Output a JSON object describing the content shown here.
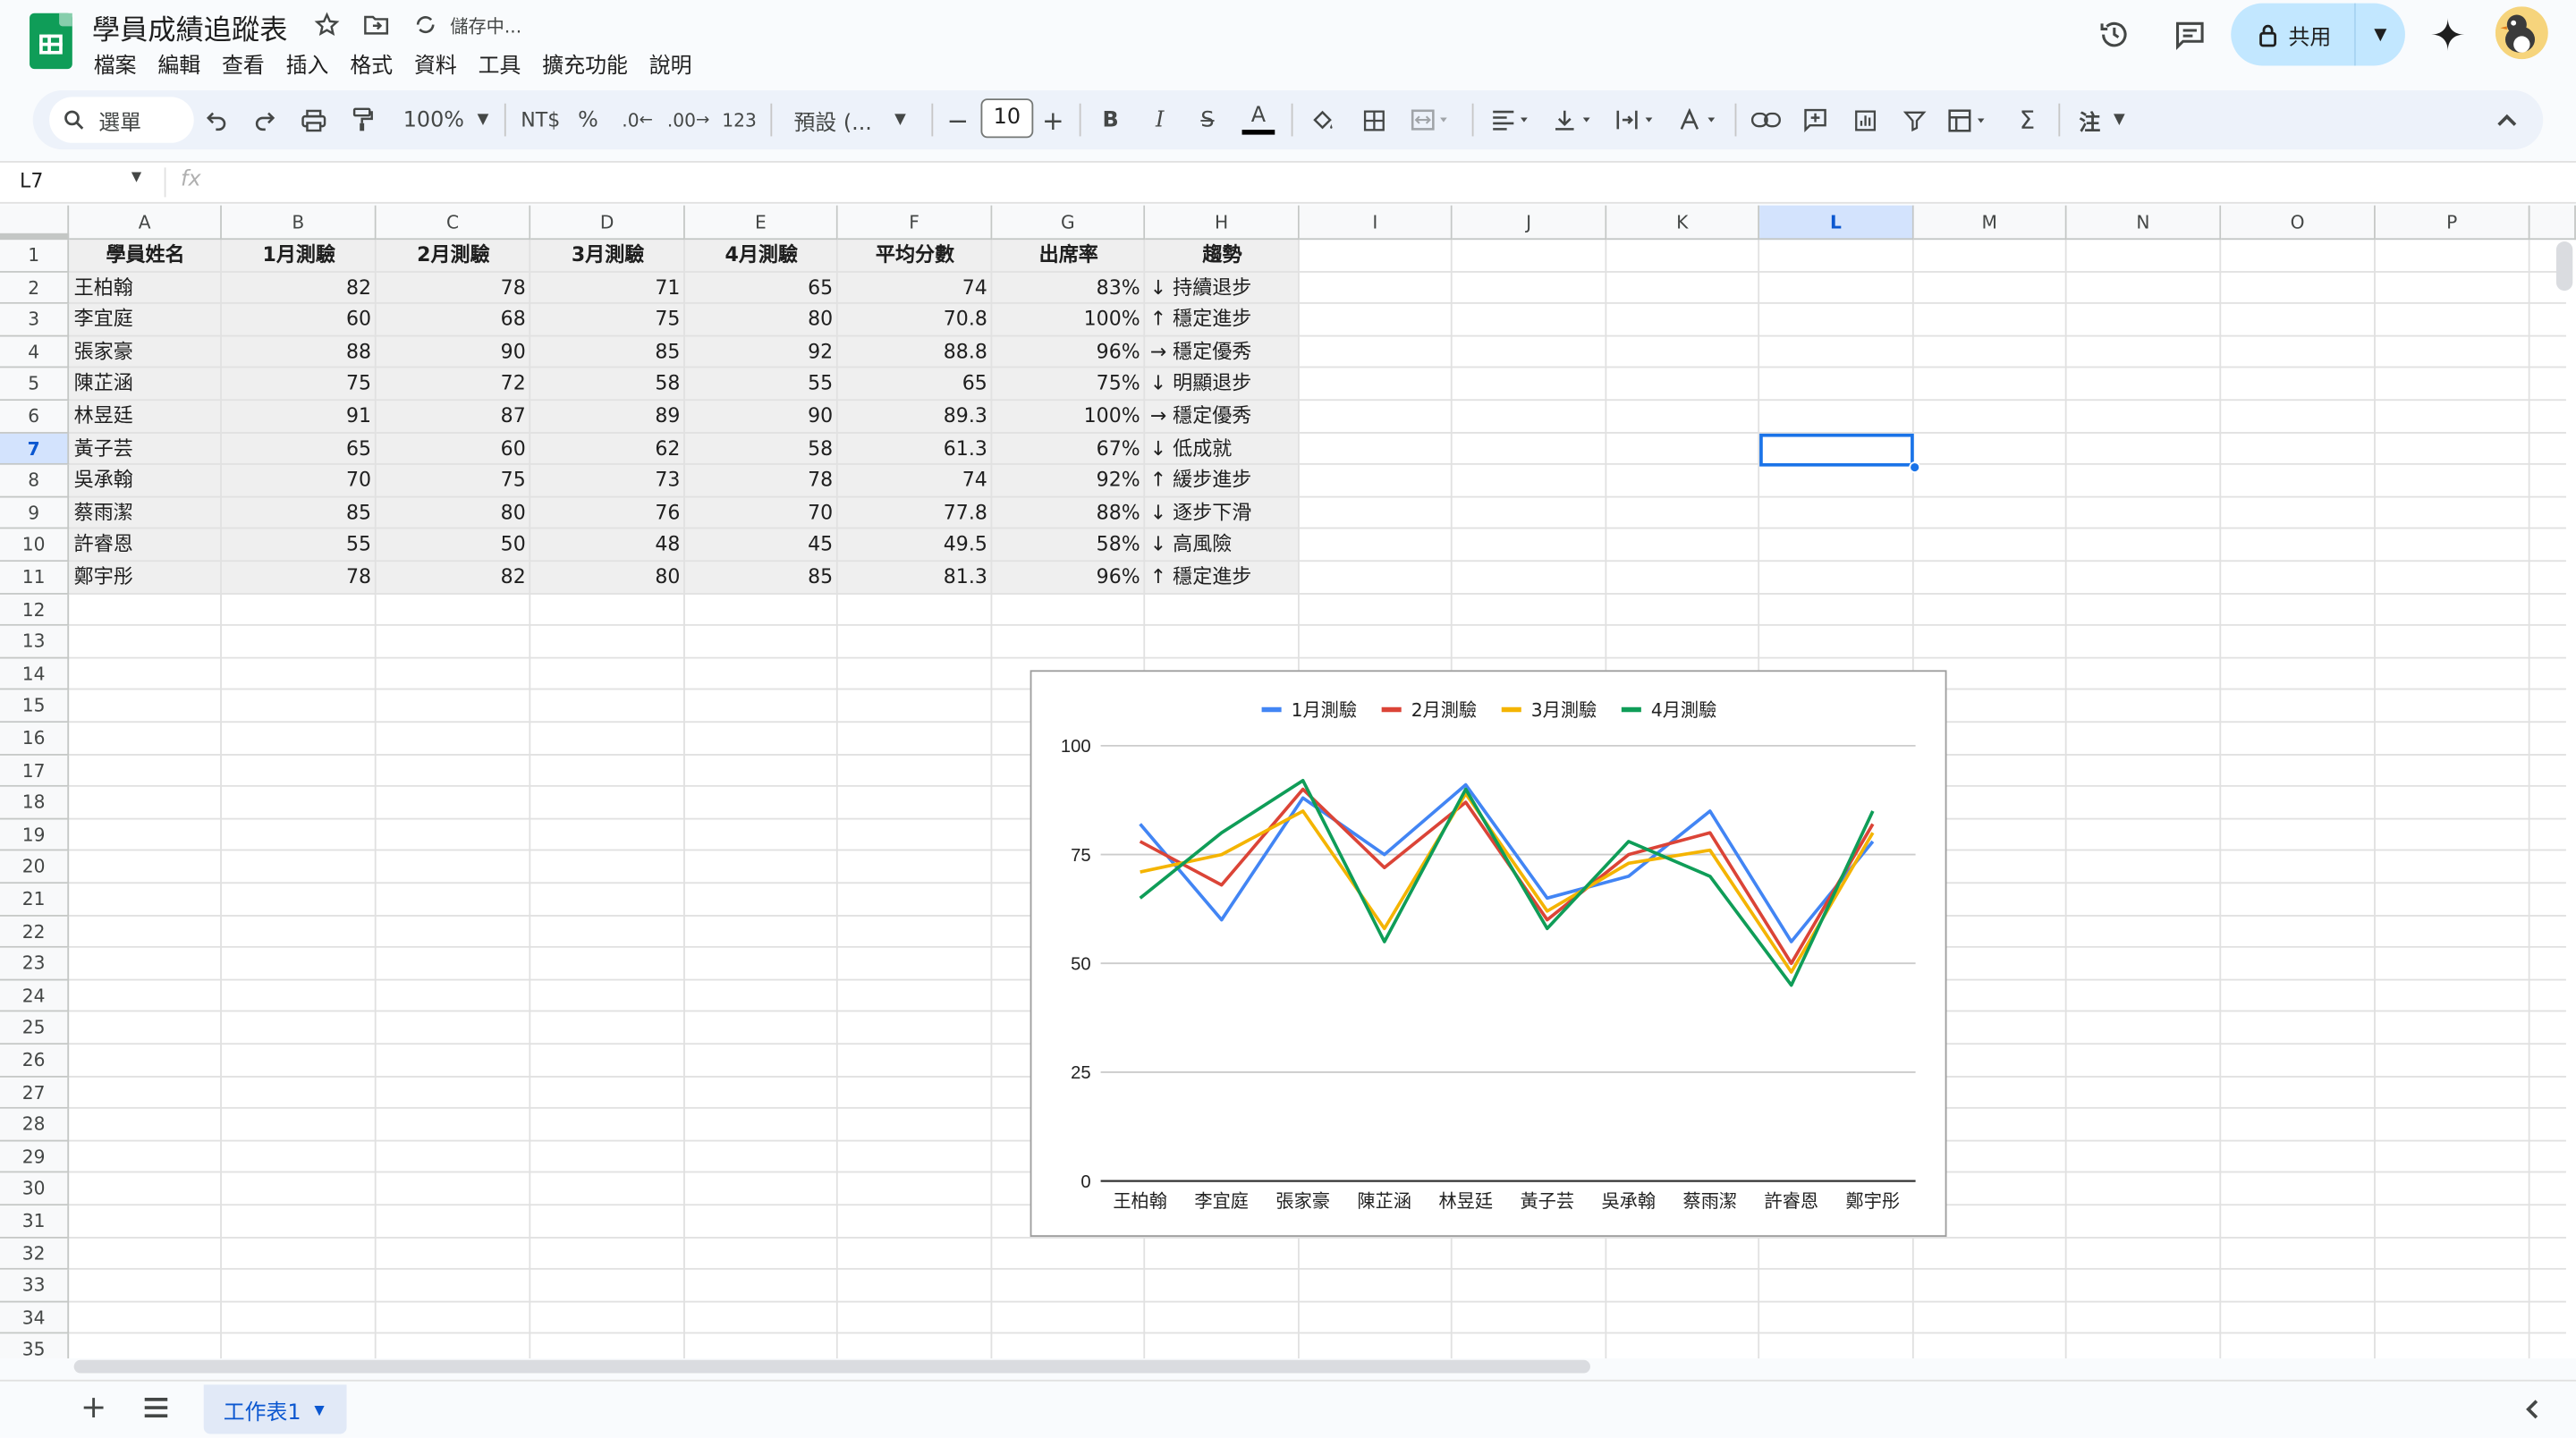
{
  "app": {
    "doc_title": "學員成績追蹤表",
    "status": "儲存中...",
    "menu": [
      "檔案",
      "編輯",
      "查看",
      "插入",
      "格式",
      "資料",
      "工具",
      "擴充功能",
      "說明"
    ],
    "share_label": "共用"
  },
  "toolbar": {
    "search_label": "選單",
    "zoom": "100%",
    "currency": "NT$",
    "percent": "%",
    "dec_minus": ".0",
    "dec_plus": ".00",
    "number_format": "123",
    "font": "預設 (...",
    "font_size": "10",
    "bold": "B",
    "italic": "I",
    "strike": "S",
    "text_color": "A",
    "sum": "Σ",
    "input_tool": "注"
  },
  "formula_bar": {
    "cell_ref": "L7",
    "fx": "fx"
  },
  "grid": {
    "columns": [
      "A",
      "B",
      "C",
      "D",
      "E",
      "F",
      "G",
      "H",
      "I",
      "J",
      "K",
      "L",
      "M",
      "N",
      "O",
      "P"
    ],
    "selected_column": "L",
    "selected_row": "7",
    "row_count": 35,
    "headers": [
      "學員姓名",
      "1月測驗",
      "2月測驗",
      "3月測驗",
      "4月測驗",
      "平均分數",
      "出席率",
      "趨勢"
    ],
    "rows": [
      [
        "王柏翰",
        "82",
        "78",
        "71",
        "65",
        "74",
        "83%",
        "↓ 持續退步"
      ],
      [
        "李宜庭",
        "60",
        "68",
        "75",
        "80",
        "70.8",
        "100%",
        "↑ 穩定進步"
      ],
      [
        "張家豪",
        "88",
        "90",
        "85",
        "92",
        "88.8",
        "96%",
        "→ 穩定優秀"
      ],
      [
        "陳芷涵",
        "75",
        "72",
        "58",
        "55",
        "65",
        "75%",
        "↓ 明顯退步"
      ],
      [
        "林昱廷",
        "91",
        "87",
        "89",
        "90",
        "89.3",
        "100%",
        "→ 穩定優秀"
      ],
      [
        "黃子芸",
        "65",
        "60",
        "62",
        "58",
        "61.3",
        "67%",
        "↓ 低成就"
      ],
      [
        "吳承翰",
        "70",
        "75",
        "73",
        "78",
        "74",
        "92%",
        "↑ 緩步進步"
      ],
      [
        "蔡雨潔",
        "85",
        "80",
        "76",
        "70",
        "77.8",
        "88%",
        "↓ 逐步下滑"
      ],
      [
        "許睿恩",
        "55",
        "50",
        "48",
        "45",
        "49.5",
        "58%",
        "↓ 高風險"
      ],
      [
        "鄭宇彤",
        "78",
        "82",
        "80",
        "85",
        "81.3",
        "96%",
        "↑ 穩定進步"
      ]
    ]
  },
  "chart_data": {
    "type": "line",
    "categories": [
      "王柏翰",
      "李宜庭",
      "張家豪",
      "陳芷涵",
      "林昱廷",
      "黃子芸",
      "吳承翰",
      "蔡雨潔",
      "許睿恩",
      "鄭宇彤"
    ],
    "series": [
      {
        "name": "1月測驗",
        "color": "#4285f4",
        "values": [
          82,
          60,
          88,
          75,
          91,
          65,
          70,
          85,
          55,
          78
        ]
      },
      {
        "name": "2月測驗",
        "color": "#db4437",
        "values": [
          78,
          68,
          90,
          72,
          87,
          60,
          75,
          80,
          50,
          82
        ]
      },
      {
        "name": "3月測驗",
        "color": "#f4b400",
        "values": [
          71,
          75,
          85,
          58,
          89,
          62,
          73,
          76,
          48,
          80
        ]
      },
      {
        "name": "4月測驗",
        "color": "#0f9d58",
        "values": [
          65,
          80,
          92,
          55,
          90,
          58,
          78,
          70,
          45,
          85
        ]
      }
    ],
    "yticks": [
      "0",
      "25",
      "50",
      "75",
      "100"
    ],
    "ylim": [
      0,
      100
    ],
    "legend_position": "top",
    "grid": true
  },
  "sheets": {
    "active": "工作表1"
  }
}
